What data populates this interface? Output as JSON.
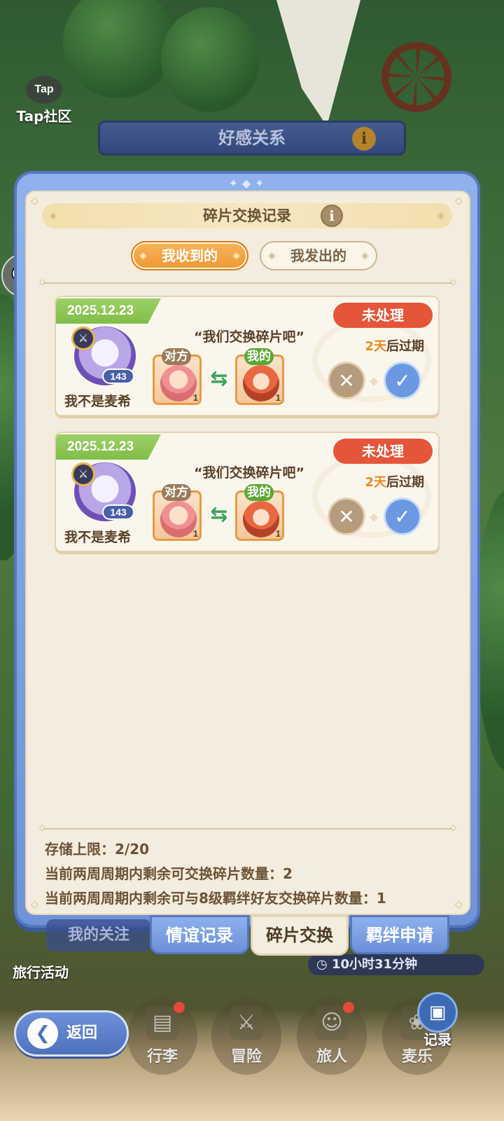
{
  "background": {
    "tap_community": {
      "logo_text": "Tap",
      "label": "Tap社区"
    },
    "favor_header": {
      "title": "好感关系",
      "info": "i"
    },
    "my_follow_tab": "我的关注",
    "travel_label": "旅行活动",
    "timer_text": "10小时31分钟"
  },
  "panel": {
    "title": "碎片交换记录",
    "info_icon": "i",
    "subtabs": [
      {
        "label": "我收到的",
        "active": true
      },
      {
        "label": "我发出的",
        "active": false
      }
    ]
  },
  "records": [
    {
      "date": "2025.12.23",
      "user_name": "我不是麦希",
      "level": "143",
      "message": "“我们交换碎片吧”",
      "status": "未处理",
      "expire_days": "2天",
      "expire_suffix": "后过期",
      "other_tag": "对方",
      "other_count": "1",
      "mine_tag": "我的",
      "mine_count": "1"
    },
    {
      "date": "2025.12.23",
      "user_name": "我不是麦希",
      "level": "143",
      "message": "“我们交换碎片吧”",
      "status": "未处理",
      "expire_days": "2天",
      "expire_suffix": "后过期",
      "other_tag": "对方",
      "other_count": "1",
      "mine_tag": "我的",
      "mine_count": "1"
    }
  ],
  "stats": {
    "storage": "存储上限：2/20",
    "remaining": "当前两周周期内剩余可交换碎片数量：2",
    "remaining_lv8": "当前两周周期内剩余可与8级羁绊好友交换碎片数量：1"
  },
  "bottom_tabs": [
    {
      "label": "情谊记录",
      "active": false
    },
    {
      "label": "碎片交换",
      "active": true
    },
    {
      "label": "羁绊申请",
      "active": false
    }
  ],
  "nav": {
    "back": "返回",
    "items": [
      "行李",
      "冒险",
      "旅人",
      "麦乐"
    ],
    "record": "记录"
  },
  "colors": {
    "accent_orange": "#ee9736",
    "status_red": "#e5553a",
    "date_green": "#80bd48",
    "panel_blue": "#6f93d8",
    "cream": "#f4ecdc"
  }
}
